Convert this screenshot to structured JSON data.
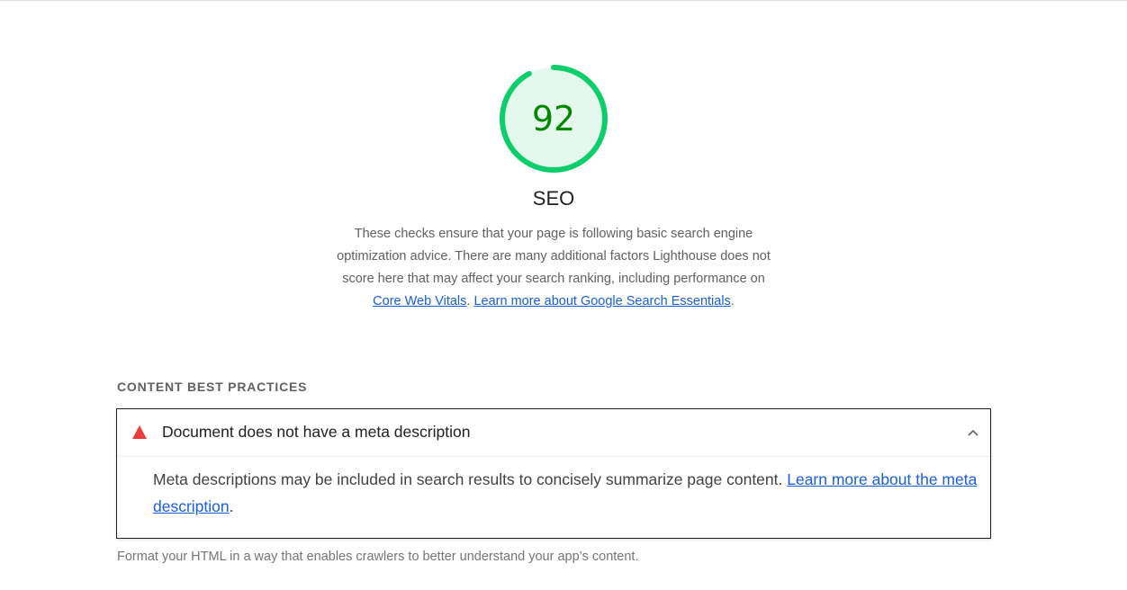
{
  "score": {
    "value": "92",
    "fraction": 0.92,
    "title": "SEO",
    "ring_color": "#0cce6b",
    "fill_color": "#e5f8ed",
    "text_color": "#008800"
  },
  "description": {
    "text": "These checks ensure that your page is following basic search engine optimization advice. There are many additional factors Lighthouse does not score here that may affect your search ranking, including performance on ",
    "link1": "Core Web Vitals",
    "sep": ". ",
    "link2": "Learn more about Google Search Essentials",
    "end": "."
  },
  "group": {
    "title": "CONTENT BEST PRACTICES",
    "description": "Format your HTML in a way that enables crawlers to better understand your app’s content."
  },
  "audit": {
    "status": "fail",
    "icon": "fail-triangle-icon",
    "status_color": "#eb3b3b",
    "title": "Document does not have a meta description",
    "body": "Meta descriptions may be included in search results to concisely summarize page content. ",
    "link": "Learn more about the meta description",
    "end": ".",
    "expanded_icon": "chevron-up-icon"
  }
}
